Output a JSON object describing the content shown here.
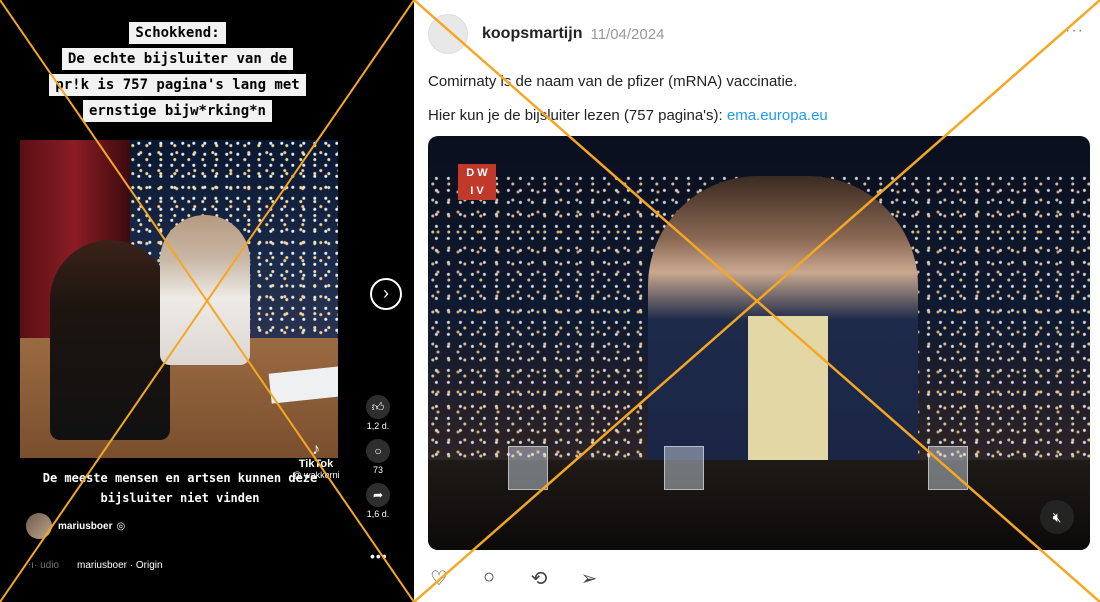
{
  "tiktok": {
    "caption_title": "Schokkend:",
    "caption_lines": [
      "De echte bijsluiter van de",
      "pr!k is 757 pagina's lang met",
      "ernstige bijw*rking*n"
    ],
    "subtitle_lines": [
      "De meeste mensen en artsen kunnen deze",
      "bijsluiter niet vinden"
    ],
    "watermark": "TikTok",
    "watermark_handle": "@ wakkerni",
    "author": "mariusboer",
    "verified_glyph": "◎",
    "likes": "1,2 d.",
    "comments": "73",
    "shares": "1,6 d.",
    "audio_label": "udio",
    "audio_source": "mariusboer · Origin",
    "icons": {
      "next": "chevron-right-circle-icon",
      "like": "thumbs-up-icon",
      "comment": "comment-icon",
      "share": "share-icon",
      "more": "more-icon"
    }
  },
  "post": {
    "username": "koopsmartijn",
    "date": "11/04/2024",
    "text_line1": "Comirnaty is de naam van de pfizer (mRNA) vaccinatie.",
    "text_line2_prefix": "Hier kun je de bijsluiter lezen (757 pagina's): ",
    "link_text": "ema.europa.eu",
    "video_logo_line1": "D W",
    "video_logo_line2": "I V",
    "icons": {
      "like": "heart-icon",
      "comment": "comment-icon",
      "repost": "repost-icon",
      "share": "send-icon",
      "mute": "mute-icon",
      "more": "more-icon"
    }
  },
  "colors": {
    "cross": "#f5a623",
    "link": "#1d9bf0",
    "tiktok_bg": "#000000"
  }
}
